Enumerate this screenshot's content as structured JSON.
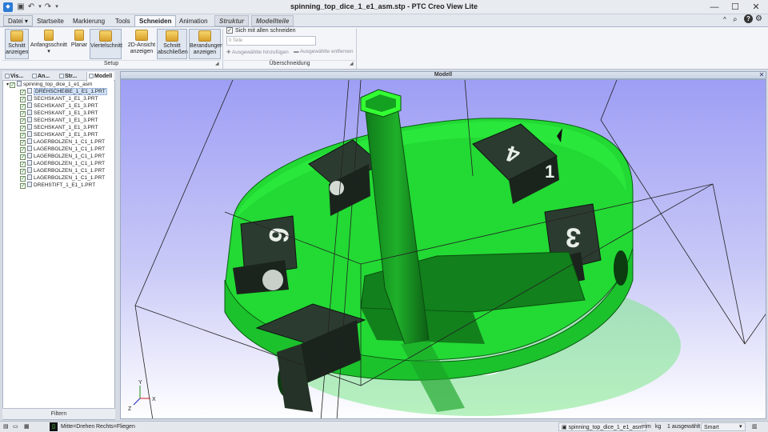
{
  "window": {
    "title": "spinning_top_dice_1_e1_asm.stp - PTC Creo View Lite"
  },
  "quick_access": {
    "app_icon": "creo-view-logo-icon",
    "save_icon": "save-icon",
    "undo_icon": "undo-icon",
    "redo_icon": "redo-icon",
    "more_icon": "chevron-down-icon"
  },
  "window_controls": {
    "minimize": "—",
    "maximize": "☐",
    "close": "✕"
  },
  "tabs": {
    "file": "Datei",
    "items": [
      "Startseite",
      "Markierung",
      "Tools",
      "Schneiden",
      "Animation"
    ],
    "active": "Schneiden",
    "contextual": [
      "Struktur",
      "Modellteile"
    ]
  },
  "help_icons": {
    "collapse": "^",
    "search": "⌕",
    "help": "?",
    "settings": "⚙"
  },
  "ribbon": {
    "setup": {
      "label": "Setup",
      "buttons": {
        "show_section": "Schnitt anzeigen",
        "initial_section": "Anfangsschnitt",
        "planar": "Planar",
        "quarter_section": "Viertelschnitt",
        "view_2d": "2D-Ansicht anzeigen",
        "finish_section": "Schnitt abschließen",
        "show_boundaries": "Berandungen anzeigen"
      }
    },
    "overlap": {
      "label": "Überschneidung",
      "cut_all_label": "Sich mit allen schneiden",
      "cut_all_checked": true,
      "parts_placeholder": "0 Teile",
      "add_selected": "Ausgewählte hinzufügen",
      "remove_selected": "Ausgewählte entfernen"
    }
  },
  "left_panel": {
    "tabs": [
      "Vis...",
      "An...",
      "Str...",
      "Modell"
    ],
    "active_tab": "Modell",
    "root": "spinning_top_dice_1_e1_asm",
    "items": [
      "DREHSCHEIBE_1_E1_1.PRT",
      "SECHSKANT_1_E1_3.PRT",
      "SECHSKANT_1_E1_3.PRT",
      "SECHSKANT_1_E1_3.PRT",
      "SECHSKANT_1_E1_3.PRT",
      "SECHSKANT_1_E1_3.PRT",
      "SECHSKANT_1_E1_3.PRT",
      "LAGERBOLZEN_1_C1_1.PRT",
      "LAGERBOLZEN_1_C1_1.PRT",
      "LAGERBOLZEN_1_C1_1.PRT",
      "LAGERBOLZEN_1_C1_1.PRT",
      "LAGERBOLZEN_1_C1_1.PRT",
      "LAGERBOLZEN_1_C1_1.PRT",
      "DREHSTIFT_1_E1_1.PRT"
    ],
    "selected_index": 0,
    "filter_label": "Filtern"
  },
  "viewport": {
    "title": "Modell",
    "axes": {
      "x": "X",
      "y": "Y",
      "z": "Z"
    },
    "dice_labels": [
      "4",
      "1",
      "3",
      "6",
      "3"
    ],
    "colors": {
      "background_top": "#9e9ef5",
      "background_bottom": "#ffffff",
      "part_green": "#22dd33",
      "highlight": "#33ff33"
    }
  },
  "status": {
    "mouse_hint_middle": "Mitte=Drehen",
    "mouse_hint_right": "Rechts=Fliegen",
    "model_name": "spinning_top_dice_1_e1_asm",
    "length_unit": "mm",
    "mass_unit": "kg",
    "selection_count": "1 ausgewählt",
    "mode": "Smart"
  }
}
